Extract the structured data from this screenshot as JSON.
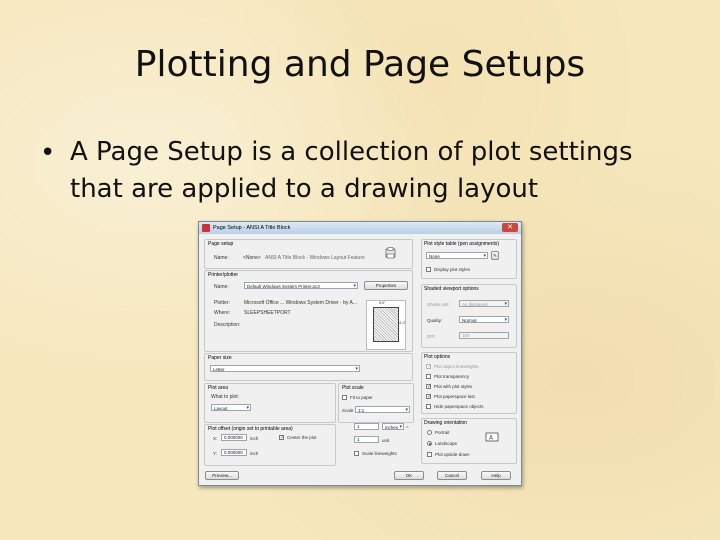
{
  "slide": {
    "title": "Plotting and Page Setups",
    "bullet": "A Page Setup is a collection of plot settings that are applied to a drawing layout"
  },
  "dialog": {
    "title": "Page Setup - ANSI A Title Block",
    "close_glyph": "✕",
    "page_setup": {
      "group": "Page setup",
      "name_label": "Name:",
      "name_value": "<None>",
      "name_note": "ANSI A Title Block - Windows Layout Feature"
    },
    "printer": {
      "group": "Printer/plotter",
      "name_label": "Name:",
      "name_value": "Default Windows System Printer.pc3",
      "properties_button": "Properties",
      "plotter_label": "Plotter:",
      "plotter_value": "Microsoft Office ... Windows System Driver - by A...",
      "where_label": "Where:",
      "where_value": "SLEEPSHEETPORT",
      "description_label": "Description:",
      "preview_dim_w": "8.5\"",
      "preview_dim_h": "11.0\""
    },
    "paper_size": {
      "group": "Paper size",
      "value": "Letter"
    },
    "plot_area": {
      "group": "Plot area",
      "what_label": "What to plot:",
      "what_value": "Layout"
    },
    "plot_offset": {
      "group": "Plot offset (origin set to printable area)",
      "x_label": "X:",
      "x_value": "0.000000",
      "x_unit": "inch",
      "y_label": "Y:",
      "y_value": "0.000000",
      "y_unit": "inch",
      "center_label": "Center the plot"
    },
    "plot_scale": {
      "group": "Plot scale",
      "fit_label": "Fit to paper",
      "scale_label": "Scale:",
      "scale_value": "1:1",
      "val1": "1",
      "units": "inches",
      "eq": "=",
      "val2": "1",
      "unit2": "unit",
      "lineweights_label": "Scale lineweights"
    },
    "plot_style_table": {
      "group": "Plot style table (pen assignments)",
      "value": "None",
      "display_label": "Display plot styles"
    },
    "shaded": {
      "group": "Shaded viewport options",
      "shade_label": "Shade plot:",
      "shade_value": "As displayed",
      "quality_label": "Quality:",
      "quality_value": "Normal",
      "dpi_label": "DPI:",
      "dpi_value": "100"
    },
    "plot_options": {
      "group": "Plot options",
      "items": [
        {
          "label": "Plot object lineweights",
          "checked": true,
          "disabled": true
        },
        {
          "label": "Plot transparency",
          "checked": false,
          "disabled": false
        },
        {
          "label": "Plot with plot styles",
          "checked": true,
          "disabled": false
        },
        {
          "label": "Plot paperspace last",
          "checked": true,
          "disabled": false
        },
        {
          "label": "Hide paperspace objects",
          "checked": false,
          "disabled": false
        }
      ]
    },
    "orientation": {
      "group": "Drawing orientation",
      "portrait": "Portrait",
      "landscape": "Landscape",
      "upside": "Plot upside-down"
    },
    "buttons": {
      "preview": "Preview...",
      "ok": "OK",
      "cancel": "Cancel",
      "help": "Help"
    }
  }
}
